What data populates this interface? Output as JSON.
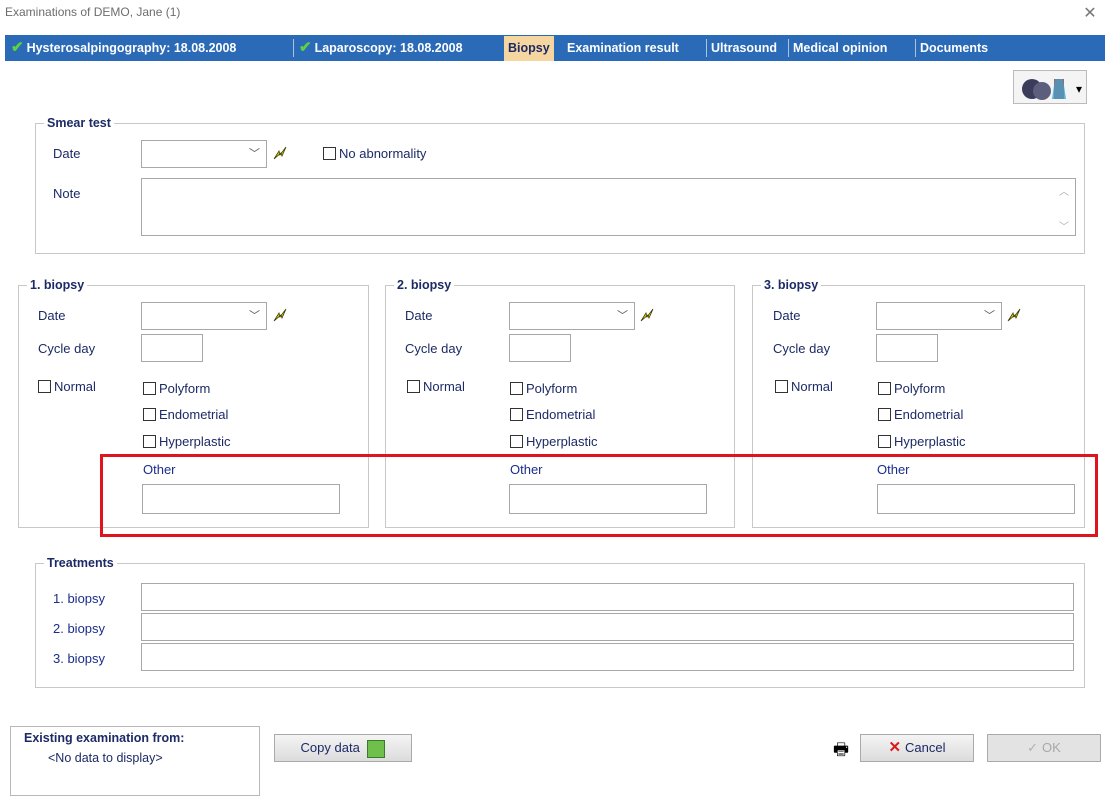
{
  "window": {
    "title": "Examinations of DEMO, Jane (1)"
  },
  "tabs": [
    {
      "label": "Hysterosalpingography: 18.08.2008",
      "checked": true
    },
    {
      "label": "Laparoscopy: 18.08.2008",
      "checked": true
    },
    {
      "label": "Biopsy",
      "active": true
    },
    {
      "label": "Examination result"
    },
    {
      "label": "Ultrasound"
    },
    {
      "label": "Medical opinion"
    },
    {
      "label": "Documents"
    }
  ],
  "smear": {
    "legend": "Smear test",
    "date_label": "Date",
    "date_value": "",
    "no_abnormality": "No abnormality",
    "note_label": "Note",
    "note_value": ""
  },
  "biopsies": [
    {
      "legend": "1. biopsy",
      "date_label": "Date",
      "cycle_label": "Cycle day",
      "normal": "Normal",
      "polyform": "Polyform",
      "endometrial": "Endometrial",
      "hyperplastic": "Hyperplastic",
      "other": "Other"
    },
    {
      "legend": "2. biopsy",
      "date_label": "Date",
      "cycle_label": "Cycle day",
      "normal": "Normal",
      "polyform": "Polyform",
      "endometrial": "Endometrial",
      "hyperplastic": "Hyperplastic",
      "other": "Other"
    },
    {
      "legend": "3. biopsy",
      "date_label": "Date",
      "cycle_label": "Cycle day",
      "normal": "Normal",
      "polyform": "Polyform",
      "endometrial": "Endometrial",
      "hyperplastic": "Hyperplastic",
      "other": "Other"
    }
  ],
  "treatments": {
    "legend": "Treatments",
    "rows": [
      "1. biopsy",
      "2. biopsy",
      "3. biopsy"
    ]
  },
  "footer": {
    "existing_label": "Existing examination from:",
    "no_data": "<No data to display>",
    "copy_data": "Copy data",
    "cancel": "Cancel",
    "ok": "OK"
  },
  "colors": {
    "tabbar": "#2a6ab7",
    "active_tab": "#f5d5a0",
    "highlight_border": "#e0141e",
    "label_blue": "#1c2a66"
  }
}
